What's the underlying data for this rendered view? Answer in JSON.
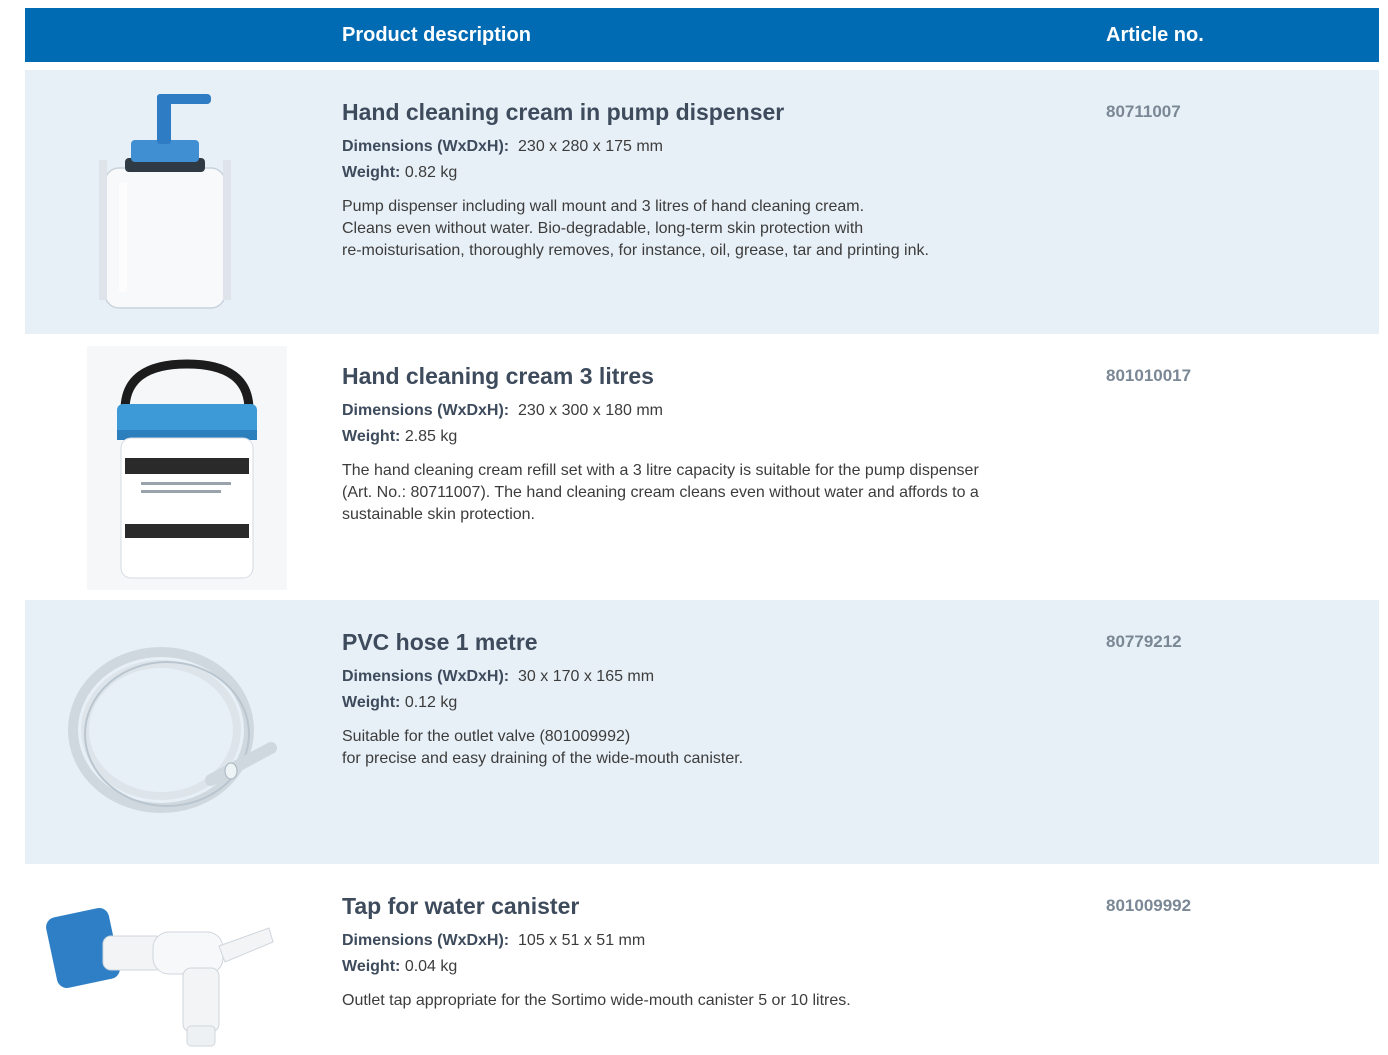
{
  "header": {
    "product_description": "Product description",
    "article_no": "Article no."
  },
  "products": [
    {
      "title": "Hand cleaning cream in pump dispenser",
      "dimensions_label": "Dimensions (WxDxH):",
      "dimensions_value": "230 x 280 x 175 mm",
      "weight_label": "Weight:",
      "weight_value": "0.82 kg",
      "description_lines": [
        "Pump dispenser including wall mount and 3 litres of hand cleaning cream.",
        "Cleans even without water. Bio-degradable, long-term skin protection with",
        "re-moisturisation, thoroughly removes, for instance, oil, grease, tar and printing ink."
      ],
      "article_no": "80711007",
      "image": "pump-dispenser-image"
    },
    {
      "title": "Hand cleaning cream 3 litres",
      "dimensions_label": "Dimensions (WxDxH):",
      "dimensions_value": "230 x 300 x 180 mm",
      "weight_label": "Weight:",
      "weight_value": "2.85 kg",
      "description_lines": [
        "The hand cleaning cream refill set with a 3 litre capacity is suitable for the pump dispenser",
        "(Art. No.: 80711007). The hand cleaning cream cleans even without water and affords to a",
        "sustainable skin protection."
      ],
      "article_no": "801010017",
      "image": "cream-bucket-image"
    },
    {
      "title": "PVC hose 1 metre",
      "dimensions_label": "Dimensions (WxDxH):",
      "dimensions_value": "30 x 170 x 165 mm",
      "weight_label": "Weight:",
      "weight_value": "0.12 kg",
      "description_lines": [
        "Suitable for the outlet valve (801009992)",
        "for precise and easy draining of the wide-mouth canister."
      ],
      "article_no": "80779212",
      "image": "pvc-hose-image"
    },
    {
      "title": "Tap for water canister",
      "dimensions_label": "Dimensions (WxDxH):",
      "dimensions_value": "105 x 51 x 51 mm",
      "weight_label": "Weight:",
      "weight_value": "0.04 kg",
      "description_lines": [
        "Outlet tap appropriate for the Sortimo wide-mouth canister 5 or 10 litres."
      ],
      "article_no": "801009992",
      "image": "water-tap-image"
    }
  ],
  "colors": {
    "header_blue": "#006ab3",
    "row_shade": "#e8f0f7",
    "title": "#3d4b5c",
    "article_no": "#7a8795"
  }
}
